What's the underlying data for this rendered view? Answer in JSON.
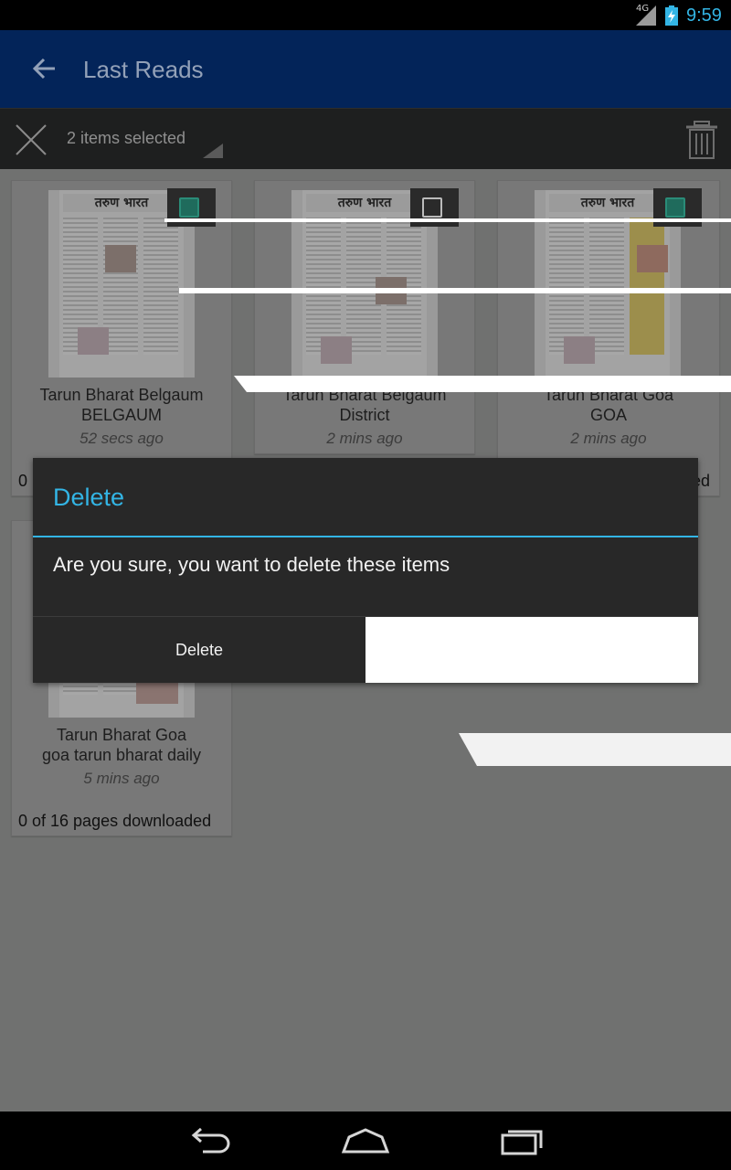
{
  "status_bar": {
    "network": "4G",
    "time": "9:59"
  },
  "app_bar": {
    "title": "Last Reads",
    "back_icon": "arrow-left-icon"
  },
  "action_mode": {
    "selected_count": "2 items selected",
    "close_icon": "close-x-icon",
    "delete_icon": "trash-icon"
  },
  "cards": [
    {
      "name": "Tarun Bharat Belgaum",
      "edition": "BELGAUM",
      "ago": "52 secs ago",
      "pages": "0",
      "checked": true
    },
    {
      "name": "Tarun Bharat Belgaum",
      "edition": "District",
      "ago": "2 mins ago",
      "checked": false
    },
    {
      "name": "Tarun Bharat Goa",
      "edition": "GOA",
      "ago": "2 mins ago",
      "pages": "ed",
      "checked": true
    },
    {
      "name": "Tarun Bharat Goa",
      "edition": "goa tarun bharat daily",
      "ago": "5 mins ago",
      "pages": "0 of 16 pages downloaded"
    }
  ],
  "thumbnail_masthead": "तरुण भारत",
  "dialog": {
    "title": "Delete",
    "message": "Are you sure, you want to delete these items",
    "positive_button": "Delete"
  },
  "nav_bar": {
    "icons": [
      "back-nav-icon",
      "home-nav-icon",
      "recents-nav-icon"
    ]
  },
  "colors": {
    "accent": "#33b5e5",
    "app_bar": "#032459",
    "dialog_bg": "#282828"
  }
}
